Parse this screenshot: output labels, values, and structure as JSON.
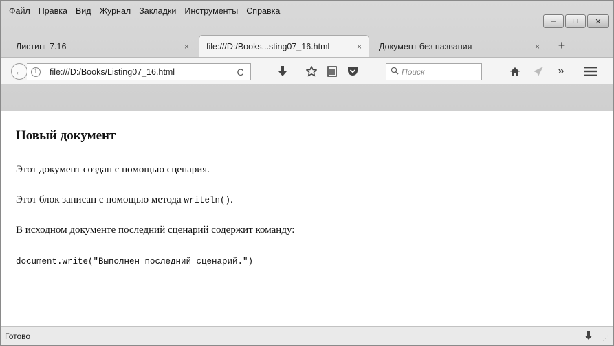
{
  "menu": {
    "items": [
      "Файл",
      "Правка",
      "Вид",
      "Журнал",
      "Закладки",
      "Инструменты",
      "Справка"
    ]
  },
  "window_controls": {
    "minimize": "–",
    "maximize": "□",
    "close": "✕"
  },
  "tabs": [
    {
      "label": "Листинг 7.16",
      "close": "×"
    },
    {
      "label": "file:///D:/Books...sting07_16.html",
      "close": "×"
    },
    {
      "label": "Документ без названия",
      "close": "×"
    }
  ],
  "new_tab": "+",
  "nav": {
    "back": "←",
    "url": "file:///D:/Books/Listing07_16.html",
    "reload": "C",
    "search_placeholder": "Поиск",
    "icons": [
      "download-icon",
      "star-icon",
      "reading-list-icon",
      "pocket-icon",
      "home-icon",
      "send-icon",
      "overflow-icon",
      "menu-icon"
    ]
  },
  "content": {
    "title": "Новый документ",
    "p1": "Этот документ создан с помощью сценария.",
    "p2_text": "Этот блок записан с помощью метода ",
    "p2_code": "writeln()",
    "p2_end": ".",
    "p3": "В исходном документе последний сценарий содержит команду:",
    "code": "document.write(\"Выполнен последний сценарий.\")"
  },
  "status": {
    "text": "Готово"
  }
}
